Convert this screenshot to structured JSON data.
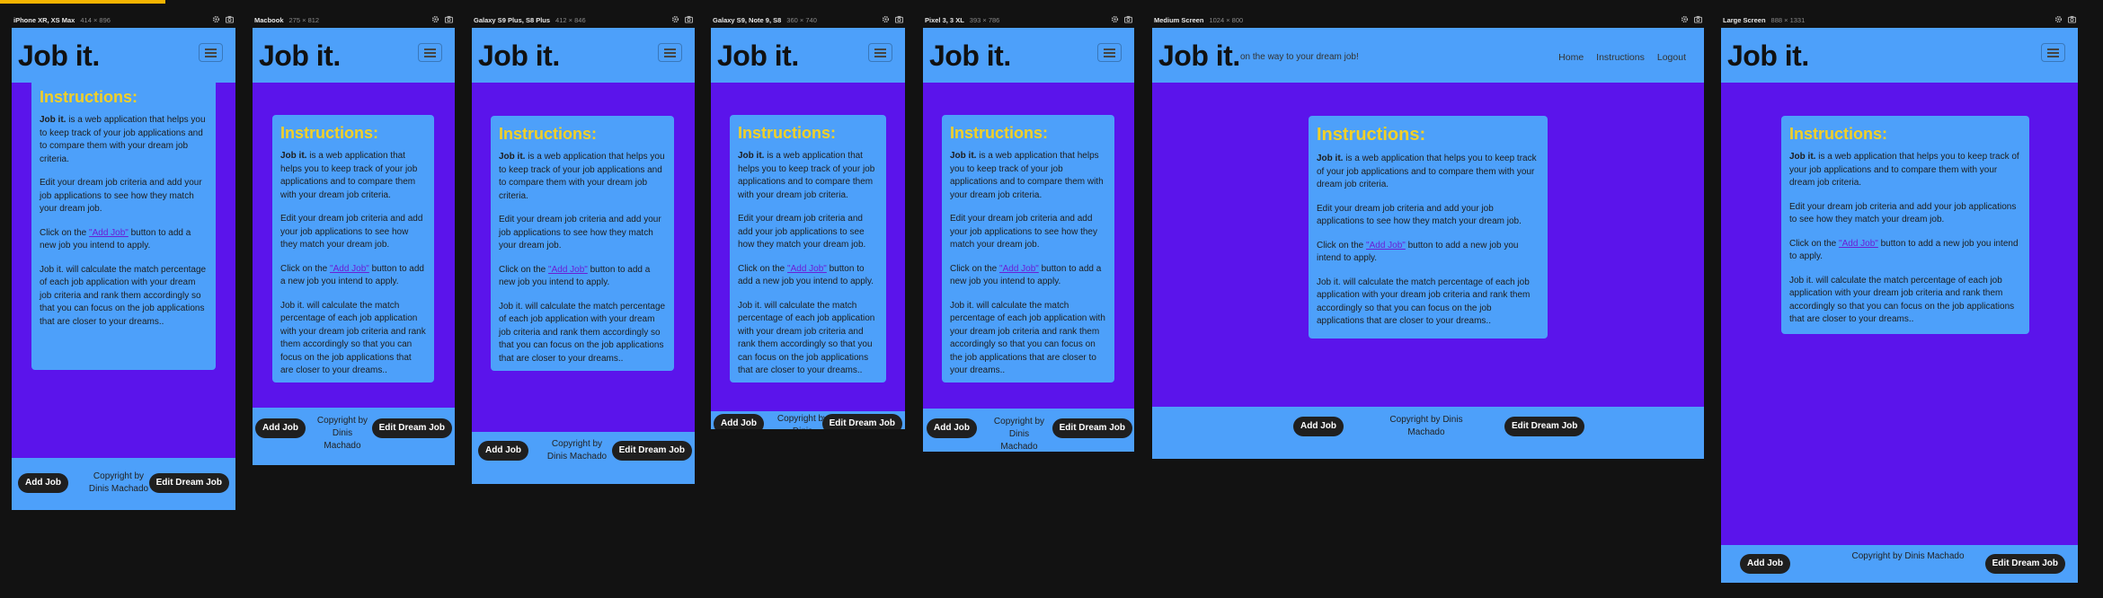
{
  "brand": "Job it.",
  "tagline": "on the way to your dream job!",
  "nav": [
    "Home",
    "Instructions",
    "Logout"
  ],
  "instructions": {
    "title": "Instructions:",
    "p1_bold": "Job it.",
    "p1_rest": " is a web application that helps you to keep track of your job applications and to compare them with your dream job criteria.",
    "p2": "Edit your dream job criteria and add your job applications to see how they match your dream job.",
    "p3_pre": "Click on the ",
    "p3_link": "\"Add Job\"",
    "p3_post": " button to add a new job you intend to apply.",
    "p4": "Job it. will calculate the match percentage of each job application with your dream job criteria and rank them accordingly so that you can focus on the job applications that are closer to your dreams.."
  },
  "footer": {
    "add_job": "Add Job",
    "copyright": "Copyright by Dinis Machado",
    "edit_dream_job": "Edit Dream Job"
  },
  "devices": [
    {
      "name": "iPhone XR, XS Max",
      "dims": "414 × 896"
    },
    {
      "name": "Macbook",
      "dims": "275 × 812"
    },
    {
      "name": "Galaxy S9 Plus, S8 Plus",
      "dims": "412 × 846"
    },
    {
      "name": "Galaxy S9, Note 9, S8",
      "dims": "360 × 740"
    },
    {
      "name": "Pixel 3, 3 XL",
      "dims": "393 × 786"
    },
    {
      "name": "Medium Screen",
      "dims": "1024 × 800"
    },
    {
      "name": "Large Screen",
      "dims": "888 × 1331"
    }
  ]
}
